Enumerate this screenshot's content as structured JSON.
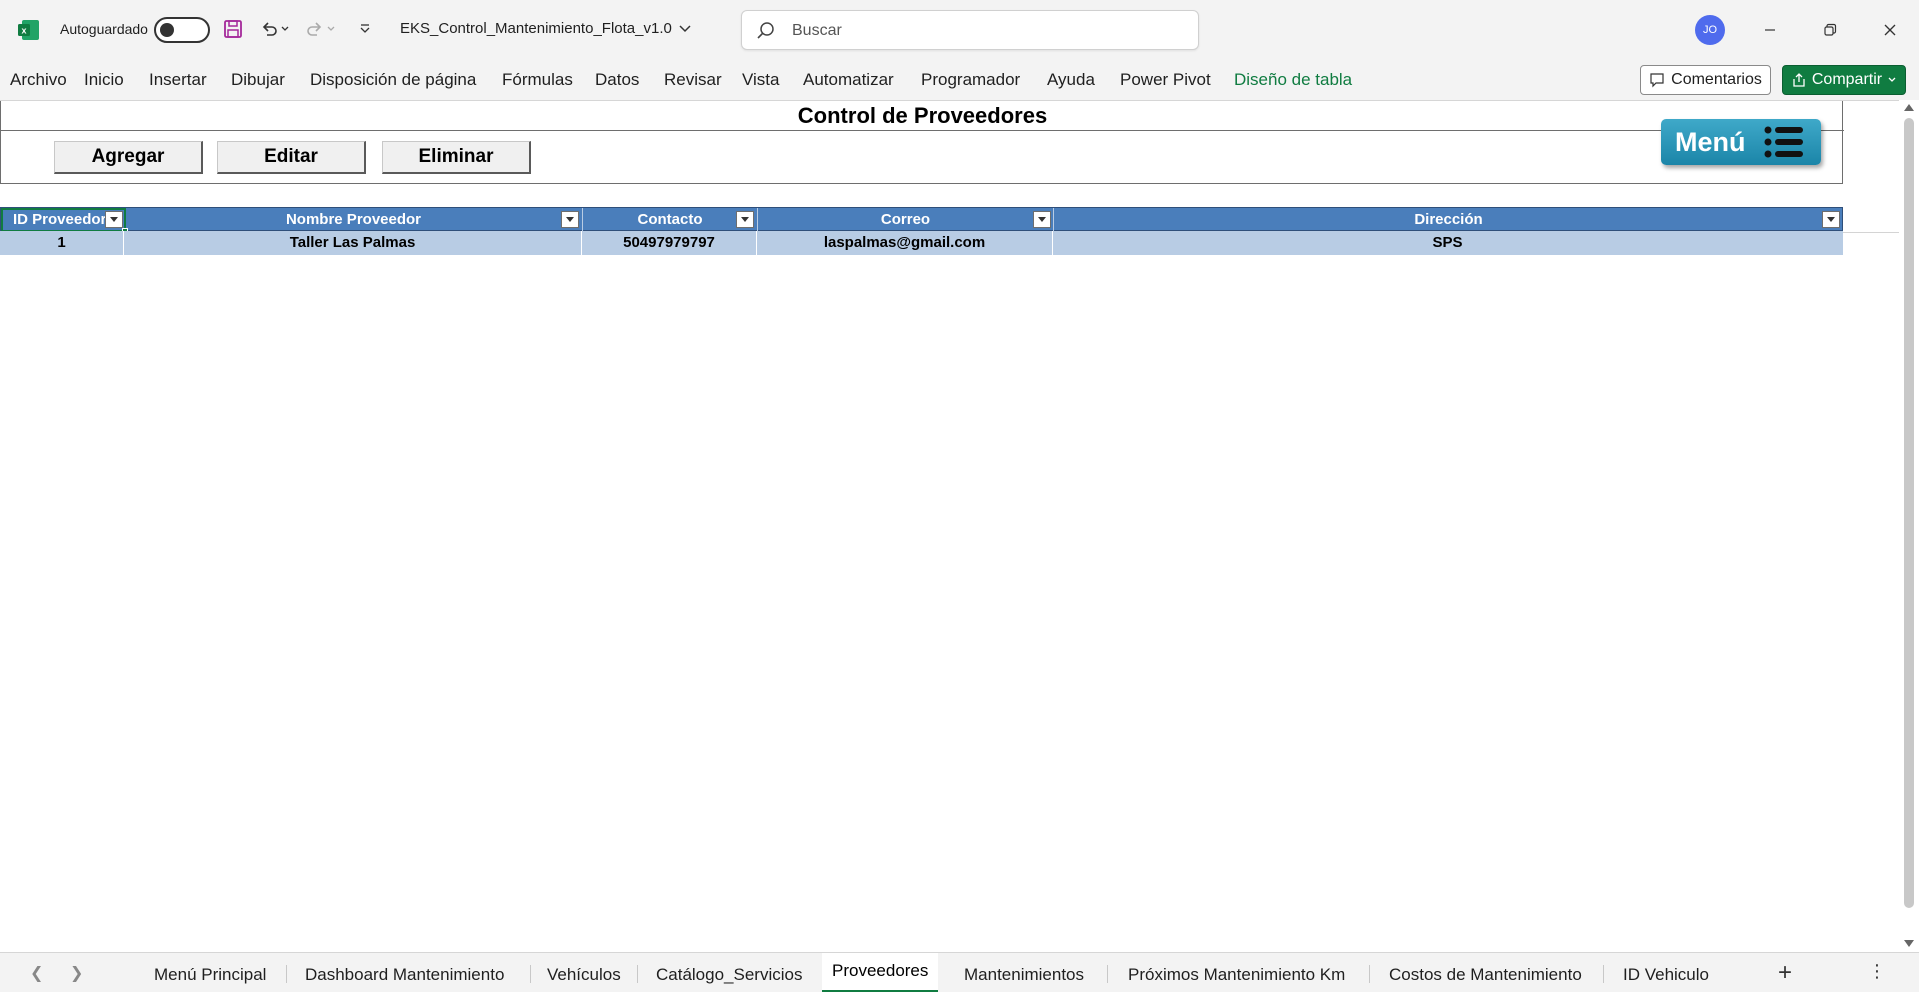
{
  "titlebar": {
    "autosave_label": "Autoguardado",
    "filename": "EKS_Control_Mantenimiento_Flota_v1.0",
    "user_initials": "JO"
  },
  "search": {
    "placeholder": "Buscar"
  },
  "ribbon": {
    "tabs": [
      "Archivo",
      "Inicio",
      "Insertar",
      "Dibujar",
      "Disposición de página",
      "Fórmulas",
      "Datos",
      "Revisar",
      "Vista",
      "Automatizar",
      "Programador",
      "Ayuda",
      "Power Pivot",
      "Diseño de tabla"
    ],
    "active_tab": "Diseño de tabla",
    "comments_label": "Comentarios",
    "share_label": "Compartir"
  },
  "panel": {
    "title": "Control de Proveedores",
    "buttons": {
      "add": "Agregar",
      "edit": "Editar",
      "delete": "Eliminar"
    },
    "menu_label": "Menú"
  },
  "table": {
    "headers": [
      "ID Proveedor",
      "Nombre Proveedor",
      "Contacto",
      "Correo",
      "Dirección"
    ],
    "rows": [
      [
        "1",
        "Taller Las Palmas",
        "50497979797",
        "laspalmas@gmail.com",
        "SPS"
      ]
    ]
  },
  "sheet_tabs": {
    "tabs": [
      "Menú Principal",
      "Dashboard Mantenimiento",
      "Vehículos",
      "Catálogo_Servicios",
      "Proveedores",
      "Mantenimientos",
      "Próximos Mantenimiento Km",
      "Costos de Mantenimiento",
      "ID Vehiculo"
    ],
    "active": "Proveedores"
  },
  "colors": {
    "excel_green": "#107c41",
    "table_header": "#4a7ebb",
    "table_row": "#b8cce4",
    "menu_button": "#1b85a8"
  }
}
